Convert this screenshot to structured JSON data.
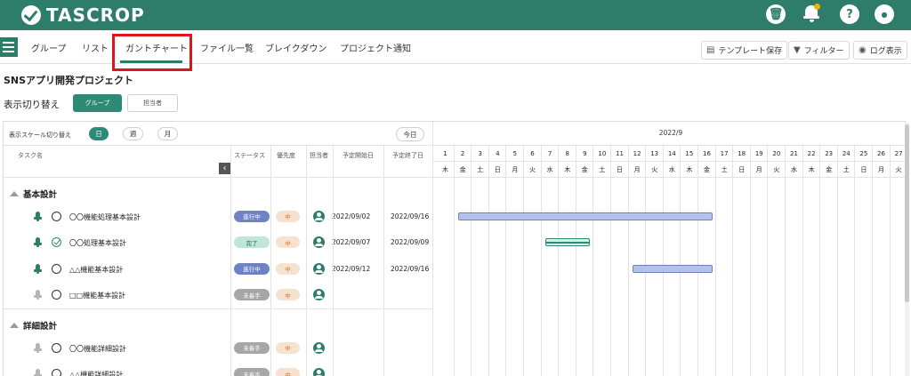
{
  "app": {
    "logo_text": "TASCROP"
  },
  "topbar": {
    "icons": [
      "trash-icon",
      "bell-icon",
      "help-icon",
      "user-icon"
    ],
    "help_glyph": "?",
    "trash_glyph": "🗑",
    "user_glyph": "●"
  },
  "tabs": [
    {
      "label": "グループ"
    },
    {
      "label": "リスト"
    },
    {
      "label": "ガントチャート",
      "active": true
    },
    {
      "label": "ファイル一覧"
    },
    {
      "label": "ブレイクダウン"
    },
    {
      "label": "プロジェクト通知"
    }
  ],
  "toolbar": {
    "template_save": "テンプレート保存",
    "filter": "フィルター",
    "log": "ログ表示"
  },
  "project": {
    "title": "SNSアプリ開発プロジェクト"
  },
  "view_toggle": {
    "label": "表示切り替え",
    "group": "グループ",
    "assignee": "担当者"
  },
  "scale": {
    "label": "表示スケール切り替え",
    "day": "日",
    "week": "週",
    "month": "月",
    "today": "今日"
  },
  "columns": {
    "task": "タスク名",
    "status": "ステータス",
    "priority": "優先度",
    "assignee": "担当者",
    "start": "予定開始日",
    "end": "予定終了日"
  },
  "colors": {
    "brand": "#2e7d6b",
    "accent": "#2e8a76",
    "highlight": "#e0141e"
  },
  "timeline": {
    "month": "2022/9",
    "days": [
      "1",
      "2",
      "3",
      "4",
      "5",
      "6",
      "7",
      "8",
      "9",
      "10",
      "11",
      "12",
      "13",
      "14",
      "15",
      "16",
      "17",
      "18",
      "19",
      "20",
      "21",
      "22",
      "23",
      "24",
      "25",
      "26",
      "27"
    ],
    "weekdays": [
      "木",
      "金",
      "土",
      "日",
      "月",
      "火",
      "水",
      "木",
      "金",
      "土",
      "日",
      "月",
      "火",
      "水",
      "木",
      "金",
      "土",
      "日",
      "月",
      "火",
      "水",
      "木",
      "金",
      "土",
      "日",
      "月",
      "火"
    ]
  },
  "groups": [
    {
      "title": "基本設計",
      "tasks": [
        {
          "name": "〇〇機能処理基本設計",
          "status": "進行中",
          "status_type": "progress",
          "priority": "中",
          "start": "2022/09/02",
          "end": "2022/09/16",
          "bar_start_day": 2,
          "bar_end_day": 16,
          "bar_color": "blue",
          "icon_done": false,
          "rocket_active": true
        },
        {
          "name": "〇〇処理基本設計",
          "status": "完了",
          "status_type": "done",
          "priority": "中",
          "start": "2022/09/07",
          "end": "2022/09/09",
          "bar_start_day": 7,
          "bar_end_day": 9,
          "bar_color": "green",
          "icon_done": true,
          "rocket_active": true
        },
        {
          "name": "△△機能基本設計",
          "status": "進行中",
          "status_type": "progress",
          "priority": "中",
          "start": "2022/09/12",
          "end": "2022/09/16",
          "bar_start_day": 12,
          "bar_end_day": 16,
          "bar_color": "blue",
          "icon_done": false,
          "rocket_active": true
        },
        {
          "name": "□□機能基本設計",
          "status": "未着手",
          "status_type": "todo",
          "priority": "中",
          "start": "",
          "end": "",
          "icon_done": false,
          "rocket_active": false
        }
      ]
    },
    {
      "title": "詳細設計",
      "tasks": [
        {
          "name": "〇〇機能詳細設計",
          "status": "未着手",
          "status_type": "todo",
          "priority": "中",
          "start": "",
          "end": "",
          "icon_done": false,
          "rocket_active": false
        },
        {
          "name": "△△機能詳細設計",
          "status": "未着手",
          "status_type": "todo",
          "priority": "中",
          "start": "",
          "end": "",
          "icon_done": false,
          "rocket_active": false
        }
      ]
    }
  ]
}
